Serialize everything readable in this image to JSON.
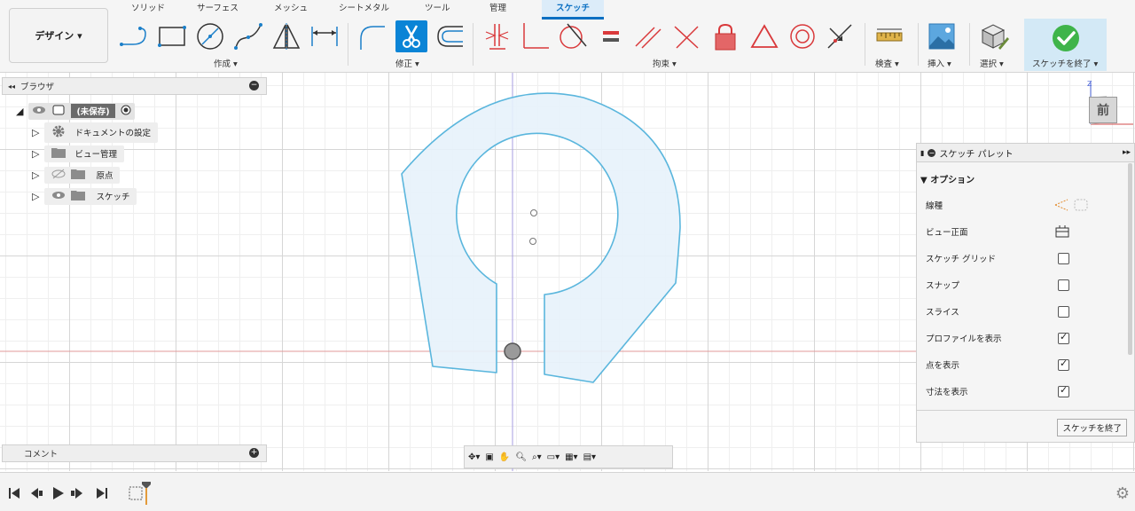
{
  "workspace": {
    "label": "デザイン ▾"
  },
  "tabs": [
    {
      "label": "ソリッド",
      "active": false
    },
    {
      "label": "サーフェス",
      "active": false
    },
    {
      "label": "メッシュ",
      "active": false
    },
    {
      "label": "シートメタル",
      "active": false
    },
    {
      "label": "ツール",
      "active": false
    },
    {
      "label": "管理",
      "active": false
    },
    {
      "label": "スケッチ",
      "active": true
    }
  ],
  "groups": {
    "create": "作成 ▾",
    "modify": "修正 ▾",
    "constraints": "拘束 ▾",
    "inspect": "検査 ▾",
    "insert": "挿入 ▾",
    "select": "選択 ▾",
    "finish": "スケッチを終了 ▾"
  },
  "browser": {
    "title": "ブラウザ",
    "root": "(未保存)",
    "items": [
      {
        "label": "ドキュメントの設定",
        "icon": "gear-icon"
      },
      {
        "label": "ビュー管理",
        "icon": "folder-icon"
      },
      {
        "label": "原点",
        "icon": "folder-icon"
      },
      {
        "label": "スケッチ",
        "icon": "folder-icon"
      }
    ]
  },
  "comments": {
    "title": "コメント"
  },
  "viewcube": {
    "face": "前",
    "axis": "Z"
  },
  "palette": {
    "title": "スケッチ パレット",
    "section": "オプション",
    "rows": [
      {
        "label": "線種",
        "type": "icon"
      },
      {
        "label": "ビュー正面",
        "type": "icon"
      },
      {
        "label": "スケッチ グリッド",
        "type": "checkbox",
        "checked": false
      },
      {
        "label": "スナップ",
        "type": "checkbox",
        "checked": false
      },
      {
        "label": "スライス",
        "type": "checkbox",
        "checked": false
      },
      {
        "label": "プロファイルを表示",
        "type": "checkbox",
        "checked": true
      },
      {
        "label": "点を表示",
        "type": "checkbox",
        "checked": true
      },
      {
        "label": "寸法を表示",
        "type": "checkbox",
        "checked": true
      }
    ],
    "finish_button": "スケッチを終了"
  },
  "colors": {
    "accent": "#0a84d6",
    "sketch_line": "#5ab6dd",
    "profile_fill": "#e7f2fb",
    "constraint_red": "#d9393b"
  }
}
